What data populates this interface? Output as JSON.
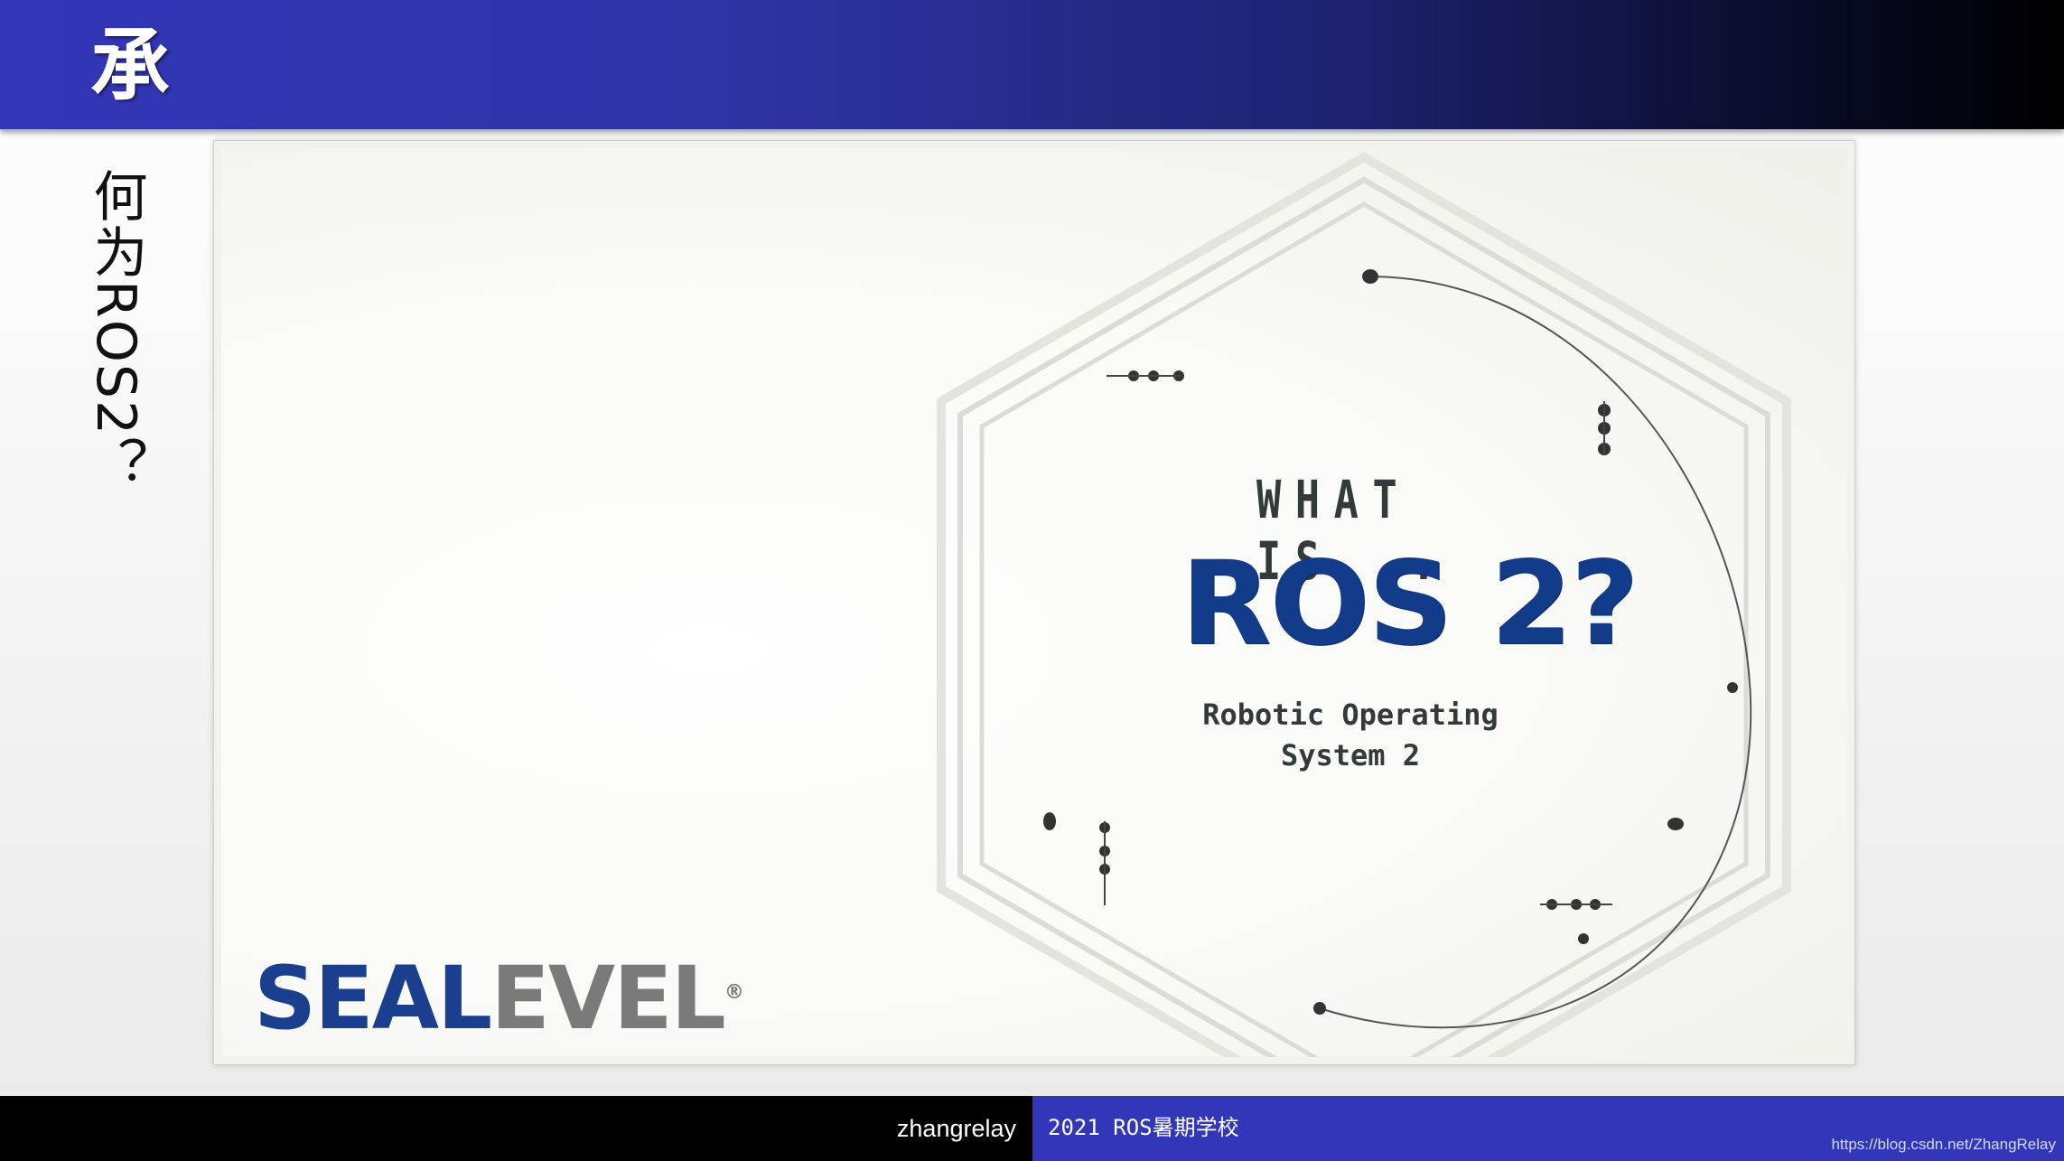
{
  "header": {
    "title": "承"
  },
  "side": {
    "title": "何为ROS2？"
  },
  "video": {
    "what_is": "WHAT IS...",
    "headline": "ROS 2?",
    "subtitle_line1": "Robotic Operating",
    "subtitle_line2": "System 2",
    "logo_part1": "SEAL",
    "logo_part2": "EVEL",
    "logo_mark": "®"
  },
  "footer": {
    "author": "zhangrelay",
    "event": "2021 ROS暑期学校",
    "url": "https://blog.csdn.net/ZhangRelay"
  },
  "colors": {
    "header_blue": "#3236b8",
    "ros_blue": "#123b8a",
    "logo_gray": "#7a7a7a"
  }
}
